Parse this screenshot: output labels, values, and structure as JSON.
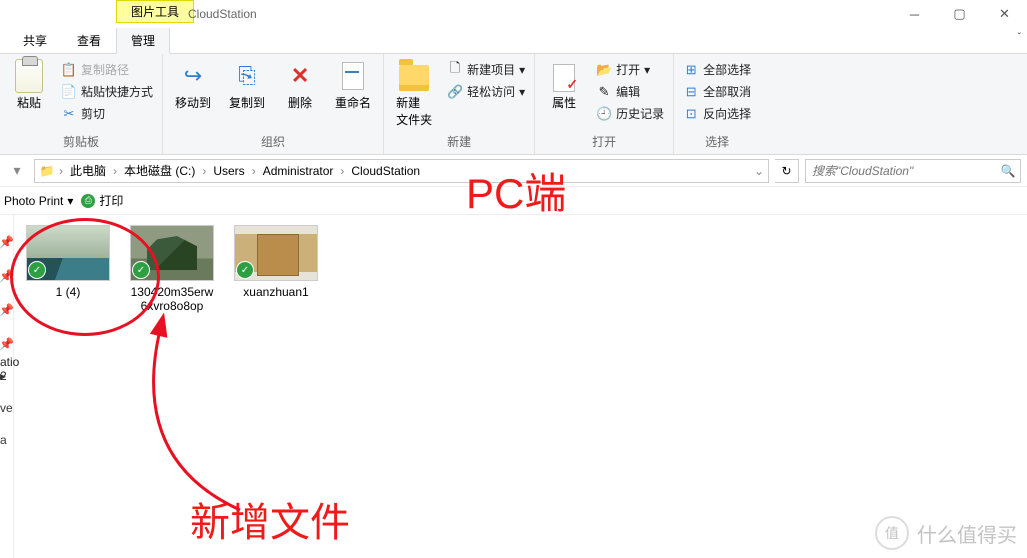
{
  "window": {
    "title": "CloudStation",
    "context_tab": "图片工具"
  },
  "tabs": {
    "share": "共享",
    "view": "查看",
    "manage": "管理"
  },
  "ribbon": {
    "clipboard": {
      "paste": "粘贴",
      "copy_path": "复制路径",
      "paste_shortcut": "粘贴快捷方式",
      "cut": "剪切",
      "label": "剪贴板"
    },
    "organize": {
      "move_to": "移动到",
      "copy_to": "复制到",
      "delete": "删除",
      "rename": "重命名",
      "label": "组织"
    },
    "new": {
      "folder": "新建\n文件夹",
      "new_item": "新建项目",
      "easy_access": "轻松访问",
      "label": "新建"
    },
    "open": {
      "properties": "属性",
      "open": "打开",
      "edit": "编辑",
      "history": "历史记录",
      "label": "打开"
    },
    "select": {
      "select_all": "全部选择",
      "select_none": "全部取消",
      "invert": "反向选择",
      "label": "选择"
    }
  },
  "breadcrumb": {
    "segs": [
      "此电脑",
      "本地磁盘 (C:)",
      "Users",
      "Administrator",
      "CloudStation"
    ],
    "search_placeholder": "搜索\"CloudStation\""
  },
  "qat": {
    "label": "Photo Print",
    "print": "打印"
  },
  "sidebar": {
    "ratio_label": "atio",
    "ratio_value": "2"
  },
  "files": [
    {
      "name": "1 (4)"
    },
    {
      "name": "130420m35erw6xvro8o8op"
    },
    {
      "name": "xuanzhuan1"
    }
  ],
  "annotations": {
    "pc": "PC端",
    "newfile": "新增文件"
  },
  "watermark": {
    "text": "什么值得买",
    "badge": "值"
  }
}
